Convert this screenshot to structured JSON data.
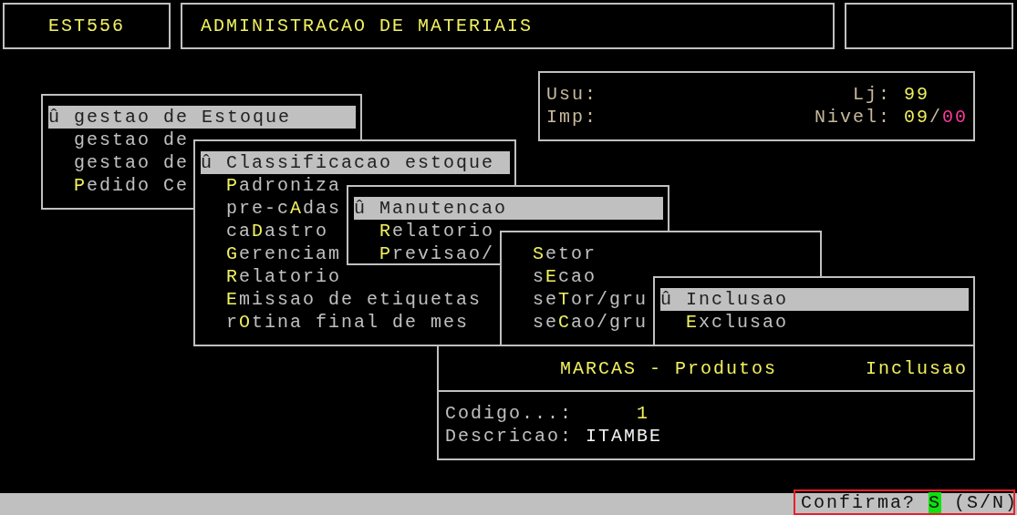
{
  "header": {
    "program": "EST556",
    "title": "ADMINISTRACAO DE MATERIAIS"
  },
  "info": {
    "user_label": "Usu:",
    "printer_label": "Imp:",
    "store_label": "Lj:",
    "store": "99",
    "level_label": "Nivel:",
    "level_value": "09",
    "level_separator": "/",
    "level_sub": "00"
  },
  "menus": [
    {
      "items": [
        {
          "pre": "û gestao de Estoque",
          "selected": true
        },
        {
          "pre": "gestao de",
          "selected": false
        },
        {
          "pre": "gestao de",
          "selected": false
        },
        {
          "key": "P",
          "post": "edido Ce",
          "selected": false
        }
      ]
    },
    {
      "items": [
        {
          "pre": "û Classificacao estoque",
          "selected": true
        },
        {
          "key": "P",
          "post": "adroniza",
          "selected": false
        },
        {
          "pre": "pre-c",
          "key": "A",
          "post": "das",
          "selected": false
        },
        {
          "pre": "ca",
          "key": "D",
          "post": "astro",
          "selected": false
        },
        {
          "key": "G",
          "post": "erenciam",
          "selected": false
        },
        {
          "key": "R",
          "post": "elatorio",
          "selected": false
        },
        {
          "key": "E",
          "post": "missao de etiquetas",
          "selected": false
        },
        {
          "pre": "r",
          "key": "O",
          "post": "tina final de mes",
          "selected": false
        }
      ]
    },
    {
      "items": [
        {
          "pre": "û Manutencao",
          "selected": true
        },
        {
          "key": "R",
          "post": "elatorio",
          "selected": false
        },
        {
          "key": "P",
          "post": "revisao/",
          "selected": false
        }
      ]
    },
    {
      "items": [
        {
          "key": "S",
          "post": "etor",
          "selected": false
        },
        {
          "pre": "s",
          "key": "E",
          "post": "cao",
          "selected": false
        },
        {
          "pre": "se",
          "key": "T",
          "post": "or/gru",
          "selected": false
        },
        {
          "pre": "se",
          "key": "C",
          "post": "ao/gru",
          "selected": false
        }
      ]
    },
    {
      "items": [
        {
          "pre": "û Inclusao",
          "selected": true
        },
        {
          "key": "E",
          "post": "xclusao",
          "selected": false
        }
      ]
    }
  ],
  "form": {
    "title": "MARCAS - Produtos",
    "mode": "Inclusao",
    "fields": [
      {
        "kind": "number",
        "label": "Codigo...:",
        "value": "1"
      },
      {
        "kind": "text",
        "label": "Descricao:",
        "value": "ITAMBE"
      }
    ]
  },
  "status_bar": {
    "prompt": "Confirma?",
    "answer": "S",
    "options": "(S/N)"
  }
}
